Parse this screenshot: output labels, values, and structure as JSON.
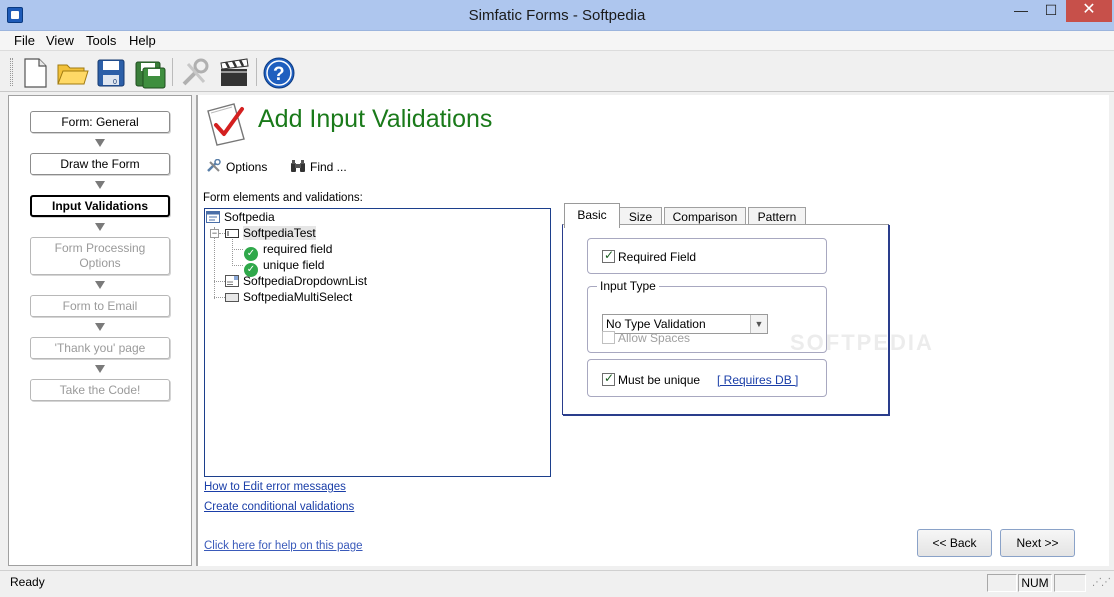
{
  "window": {
    "title": "Simfatic Forms - Softpedia",
    "min_glyph": "—",
    "max_glyph": "☐",
    "close_glyph": "✕"
  },
  "menu": [
    "File",
    "View",
    "Tools",
    "Help"
  ],
  "toolbar": {
    "buttons": [
      "new-icon",
      "open-folder-icon",
      "save-icon",
      "save-as-icon",
      "settings-tools-icon",
      "clapperboard-icon",
      "help-icon"
    ]
  },
  "steps": [
    {
      "label": "Form: General",
      "state": "normal"
    },
    {
      "label": "Draw the Form",
      "state": "normal"
    },
    {
      "label": "Input Validations",
      "state": "active"
    },
    {
      "label_line1": "Form Processing",
      "label_line2": "Options",
      "state": "disabled"
    },
    {
      "label": "Form to Email",
      "state": "disabled"
    },
    {
      "label": "'Thank you' page",
      "state": "disabled"
    },
    {
      "label": "Take the Code!",
      "state": "disabled"
    }
  ],
  "main": {
    "title": "Add Input Validations",
    "options_label": "Options",
    "find_label": "Find ...",
    "tree_label": "Form elements and validations:",
    "tree": {
      "root": "Softpedia",
      "item1": "SoftpediaTest",
      "item1_expander": "−",
      "validation1": "required field",
      "validation2": "unique field",
      "item2": "SoftpediaDropdownList",
      "item3": "SoftpediaMultiSelect"
    },
    "link_edit_errors": "How to Edit error messages",
    "link_conditional": "Create conditional validations",
    "link_help": "Click here for help on this page"
  },
  "tabs": [
    "Basic",
    "Size",
    "Comparison",
    "Pattern"
  ],
  "basic_tab": {
    "required_field": {
      "label": "Required Field",
      "checked": true
    },
    "input_type_title": "Input Type",
    "input_type_value": "No Type Validation",
    "allow_spaces": {
      "label": "Allow Spaces",
      "checked": false,
      "disabled": true
    },
    "must_be_unique": {
      "label": "Must be unique",
      "checked": true
    },
    "requires_db_link": "[ Requires DB ]"
  },
  "watermark": "SOFTPEDIA",
  "nav": {
    "back": "<< Back",
    "next": "Next >>"
  },
  "status": {
    "text": "Ready",
    "num": "NUM"
  }
}
